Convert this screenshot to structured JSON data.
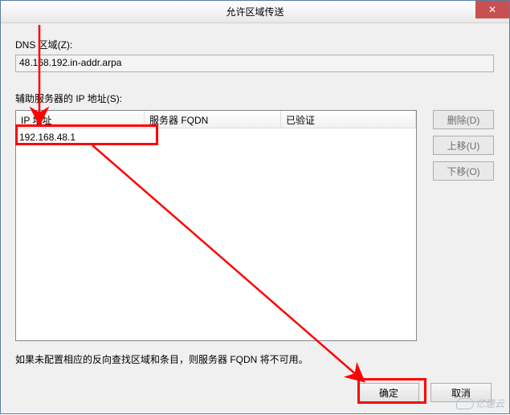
{
  "titlebar": {
    "title": "允许区域传送",
    "close_glyph": "✕"
  },
  "zone": {
    "label": "DNS 区域(Z):",
    "value": "48.168.192.in-addr.arpa"
  },
  "servers": {
    "label": "辅助服务器的 IP 地址(S):",
    "columns": {
      "ip": "IP 地址",
      "fqdn": "服务器 FQDN",
      "verified": "已验证"
    },
    "row_ip": "192.168.48.1"
  },
  "side": {
    "delete": "删除(D)",
    "move_up": "上移(U)",
    "move_down": "下移(O)"
  },
  "note": "如果未配置相应的反向查找区域和条目，则服务器 FQDN 将不可用。",
  "footer": {
    "ok": "确定",
    "cancel": "取消"
  },
  "watermark": "亿速云"
}
